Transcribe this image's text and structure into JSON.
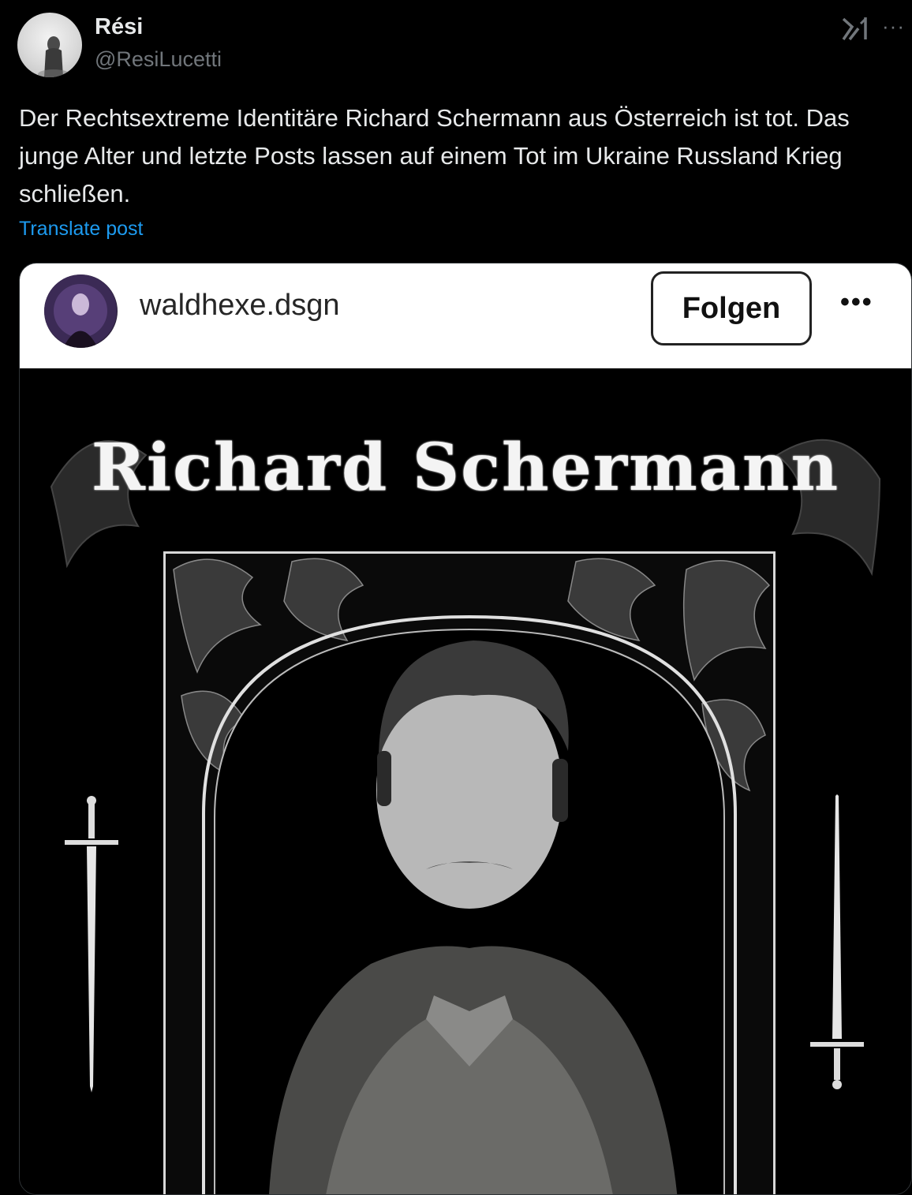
{
  "tweet": {
    "author_name": "Rési",
    "author_handle": "@ResiLucetti",
    "text": "Der Rechtsextreme Identitäre Richard Schermann aus Österreich ist tot. Das junge Alter und letzte Posts lassen auf einem Tot im Ukraine Russland Krieg schließen.",
    "translate_label": "Translate post",
    "more_label": "···",
    "icons": [
      "grok-icon",
      "more-icon"
    ]
  },
  "embed": {
    "username": "waldhexe.dsgn",
    "follow_label": "Folgen",
    "more_label": "•••",
    "poster_title": "Richard Schermann"
  },
  "colors": {
    "background": "#000000",
    "link": "#1d9bf0",
    "secondary_text": "#71767b"
  }
}
